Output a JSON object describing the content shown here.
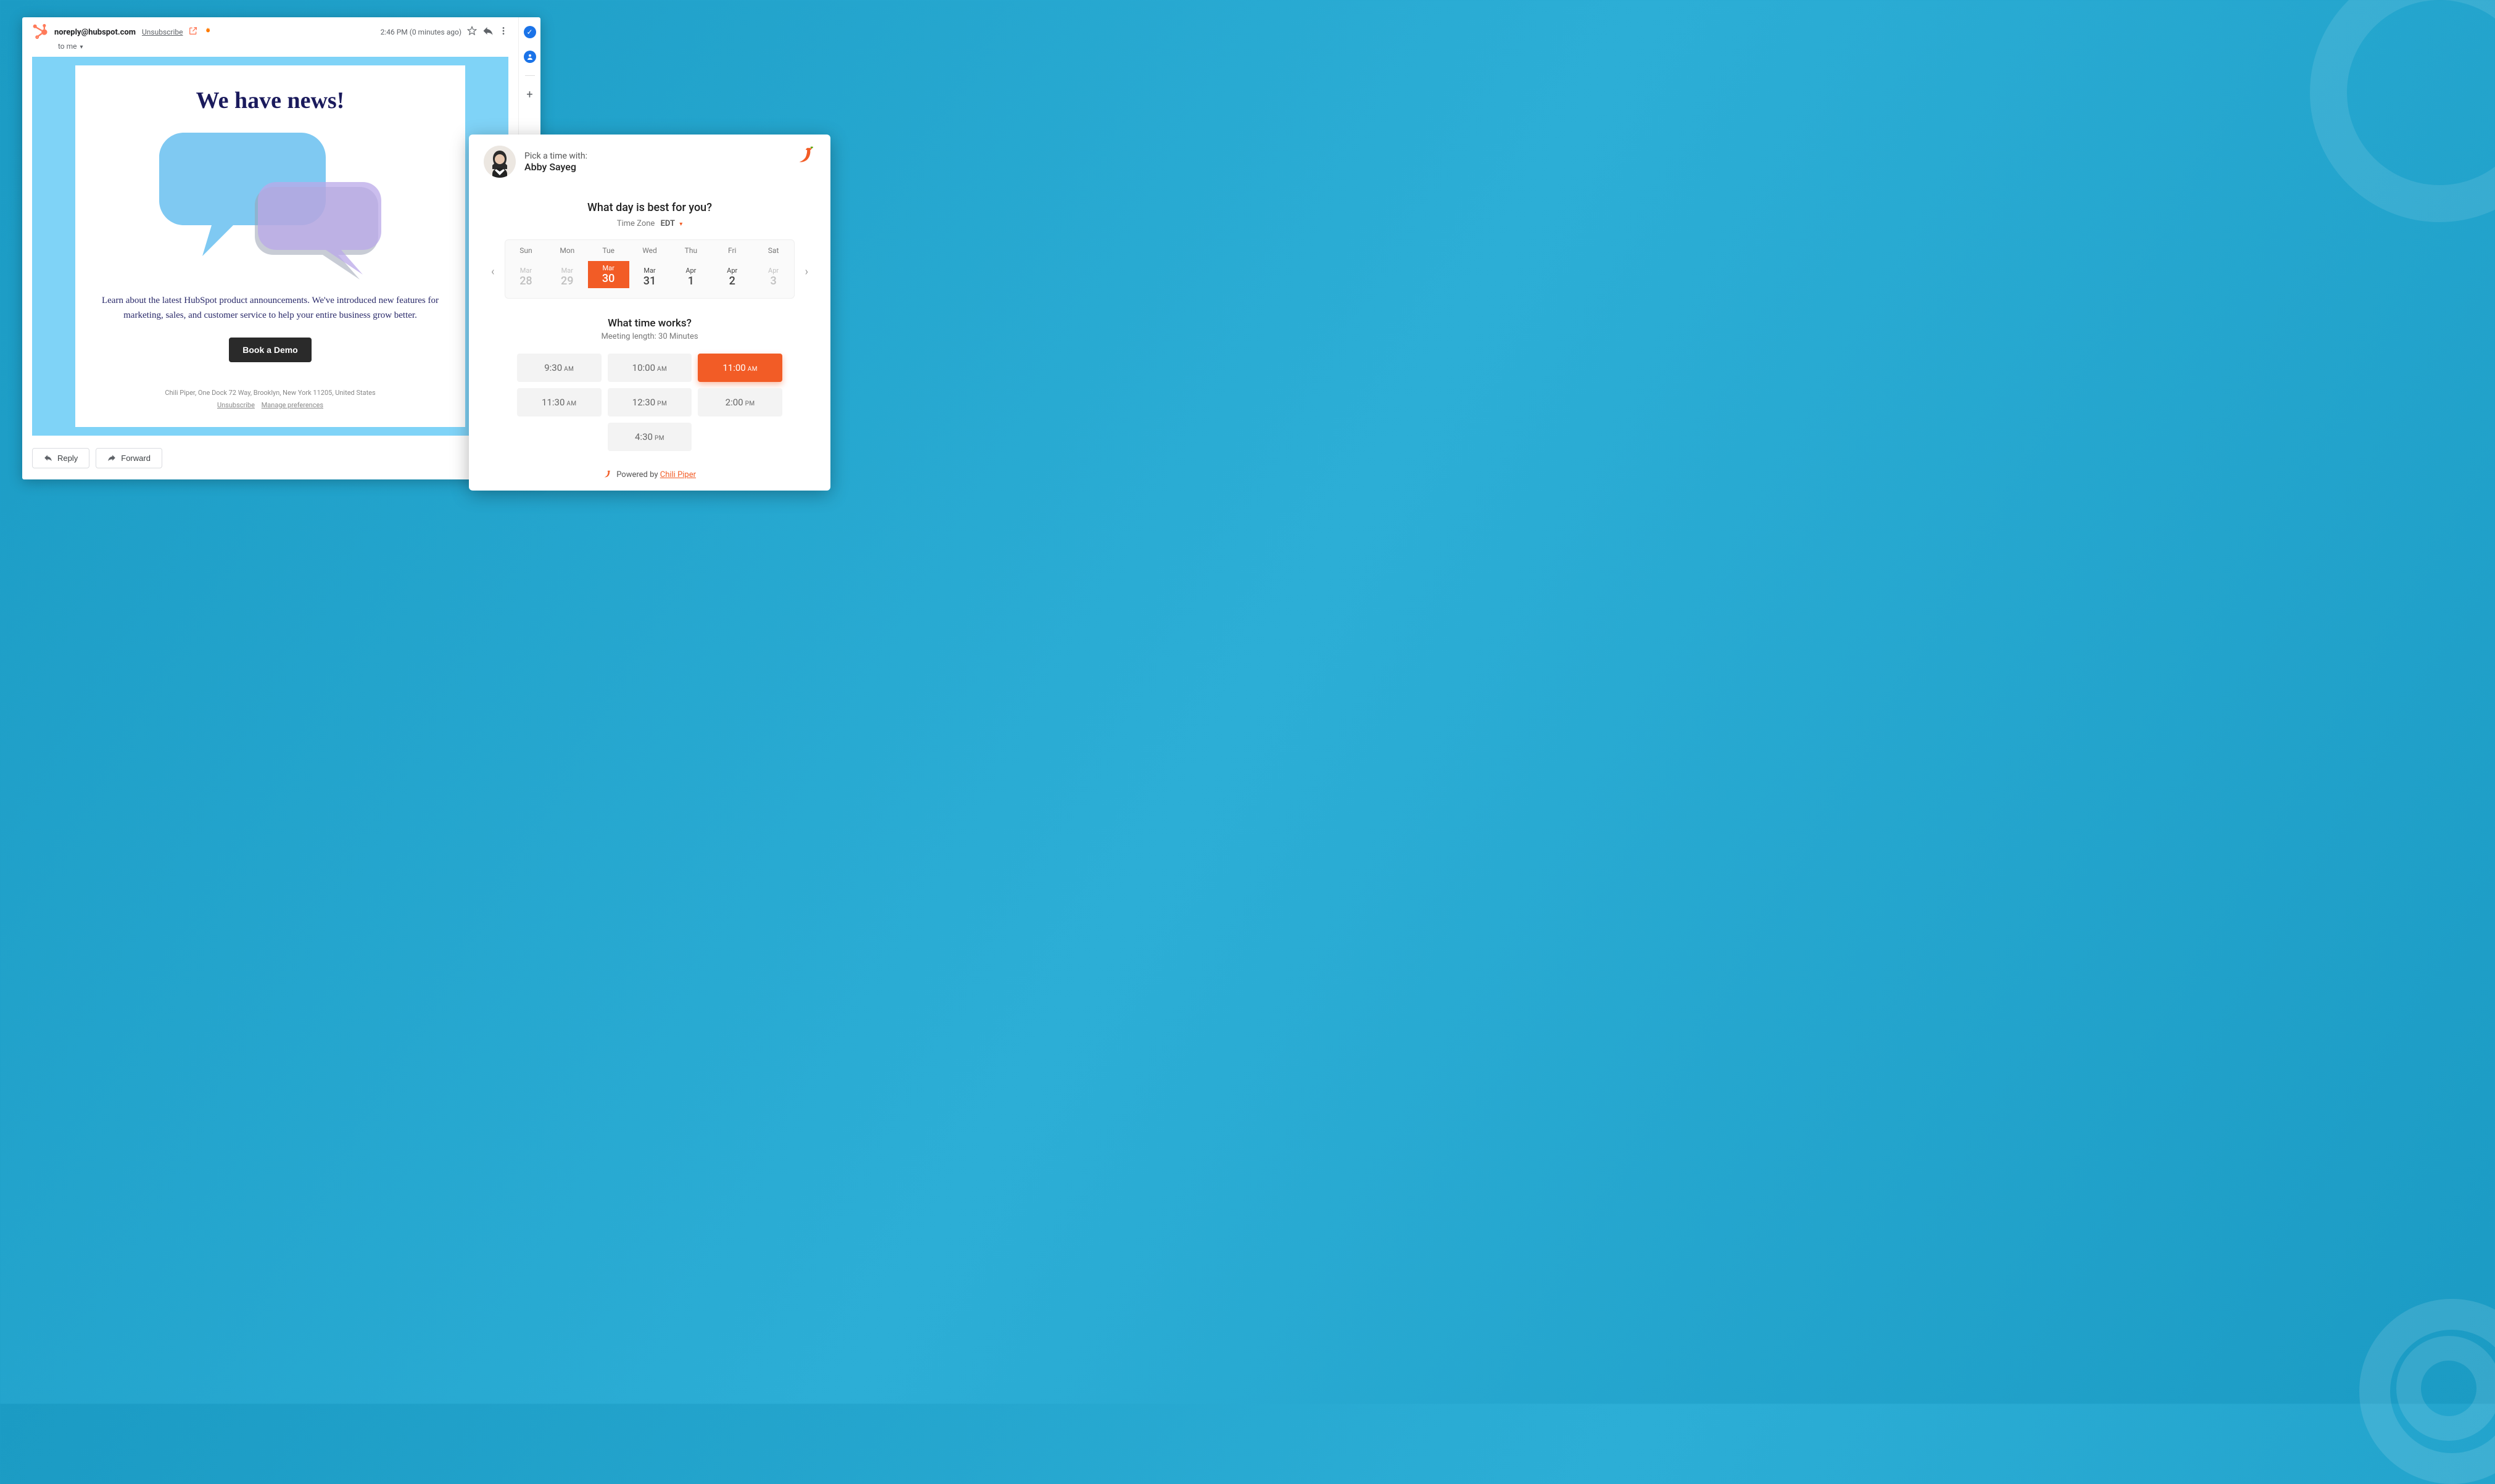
{
  "email": {
    "from": "noreply@hubspot.com",
    "unsubscribe": "Unsubscribe",
    "timestamp": "2:46 PM (0 minutes ago)",
    "to_line": "to me",
    "title": "We have news!",
    "description": "Learn about the latest HubSpot product announcements. We've introduced new features for marketing, sales, and customer service to help your entire business grow better.",
    "cta": "Book a Demo",
    "footer_address": "Chili Piper, One Dock 72 Way, Brooklyn, New York 11205, United States",
    "footer_unsub": "Unsubscribe",
    "footer_prefs": "Manage preferences",
    "reply": "Reply",
    "forward": "Forward"
  },
  "scheduler": {
    "pick_label": "Pick a time with:",
    "host": "Abby Sayeg",
    "day_q": "What day is best for you?",
    "tz_label": "Time Zone",
    "tz_value": "EDT",
    "days": [
      "Sun",
      "Mon",
      "Tue",
      "Wed",
      "Thu",
      "Fri",
      "Sat"
    ],
    "dates": [
      {
        "m": "Mar",
        "d": "28",
        "muted": true,
        "selected": false
      },
      {
        "m": "Mar",
        "d": "29",
        "muted": true,
        "selected": false
      },
      {
        "m": "Mar",
        "d": "30",
        "muted": false,
        "selected": true
      },
      {
        "m": "Mar",
        "d": "31",
        "muted": false,
        "selected": false
      },
      {
        "m": "Apr",
        "d": "1",
        "muted": false,
        "selected": false
      },
      {
        "m": "Apr",
        "d": "2",
        "muted": false,
        "selected": false
      },
      {
        "m": "Apr",
        "d": "3",
        "muted": true,
        "selected": false
      }
    ],
    "time_q": "What time works?",
    "meeting_len": "Meeting length: 30 Minutes",
    "slots": [
      {
        "t": "9:30",
        "ap": "AM",
        "selected": false
      },
      {
        "t": "10:00",
        "ap": "AM",
        "selected": false
      },
      {
        "t": "11:00",
        "ap": "AM",
        "selected": true
      },
      {
        "t": "11:30",
        "ap": "AM",
        "selected": false
      },
      {
        "t": "12:30",
        "ap": "PM",
        "selected": false
      },
      {
        "t": "2:00",
        "ap": "PM",
        "selected": false
      },
      {
        "t": "4:30",
        "ap": "PM",
        "selected": false,
        "offset": true
      }
    ],
    "powered_prefix": "Powered by ",
    "powered_link": "Chili Piper"
  }
}
